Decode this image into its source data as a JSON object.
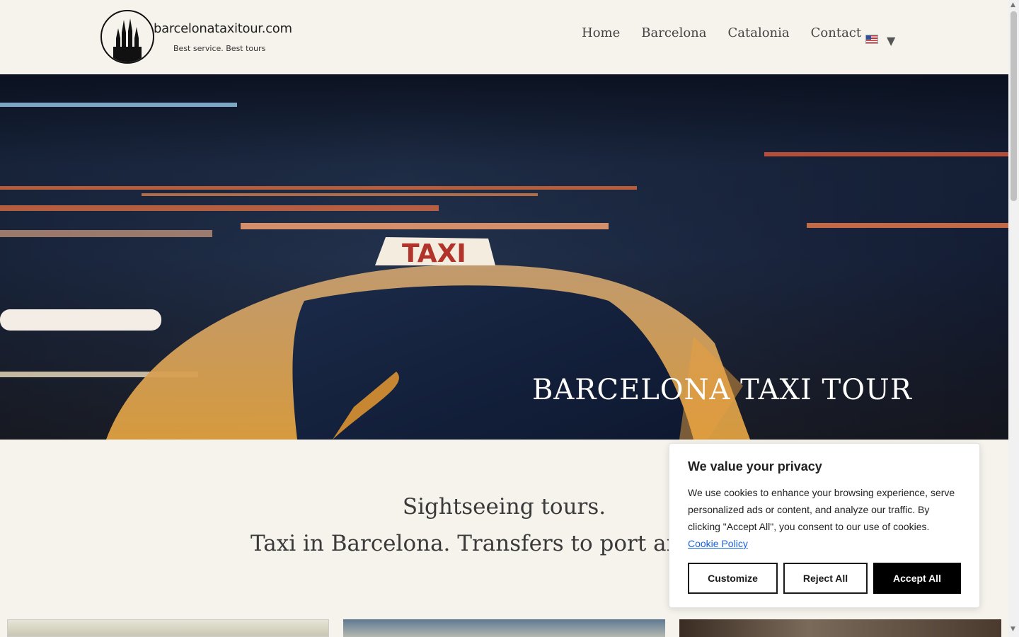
{
  "header": {
    "logo_name": "barcelonataxitour.com",
    "logo_tagline": "Best service. Best tours",
    "nav": [
      "Home",
      "Barcelona",
      "Catalonia",
      "Contact"
    ],
    "language_icon": "us-flag-icon",
    "language_caret": "▼"
  },
  "hero": {
    "title": "BARCELONA TAXI TOUR",
    "sign_text": "TAXI"
  },
  "main": {
    "title_line1": "Sightseeing tours.",
    "title_line2": "Taxi in Barcelona. Transfers to port and"
  },
  "cookie": {
    "title": "We value your privacy",
    "body": "We use cookies to enhance your browsing experience, serve personalized ads or content, and analyze our traffic. By clicking \"Accept All\", you consent to our use of cookies.",
    "link": "Cookie Policy",
    "customize_label": "Customize",
    "reject_label": "Reject All",
    "accept_label": "Accept All"
  },
  "colors": {
    "background": "#f6f2ec",
    "link": "#1863dc",
    "accept_bg": "#000000"
  }
}
